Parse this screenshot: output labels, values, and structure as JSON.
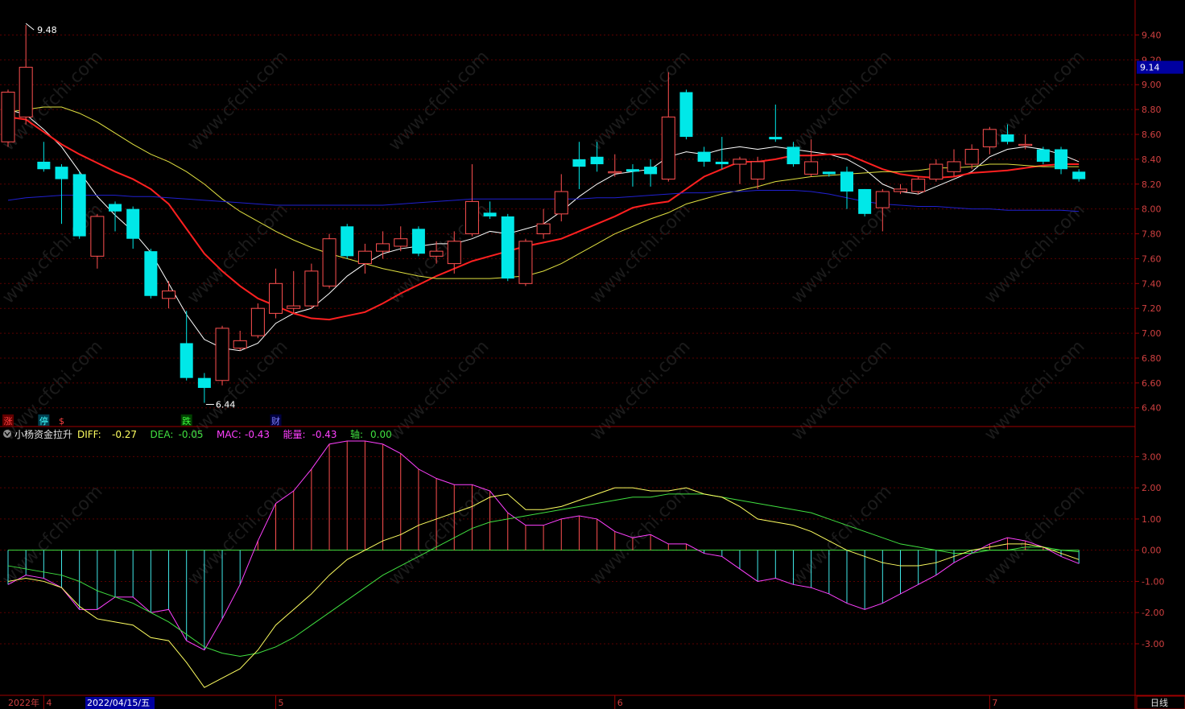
{
  "chart_data": {
    "type": "candlestick",
    "price_axis": {
      "ticks": [
        "9.40",
        "9.20",
        "9.00",
        "8.80",
        "8.60",
        "8.40",
        "8.20",
        "8.00",
        "7.80",
        "7.60",
        "7.40",
        "7.20",
        "7.00",
        "6.80",
        "6.60",
        "6.40"
      ],
      "range": [
        6.34,
        9.5
      ]
    },
    "current_price_tag": "9.14",
    "max_label": "9.48",
    "min_label": "6.44",
    "candles": [
      {
        "o": 8.54,
        "c": 8.94,
        "h": 8.96,
        "l": 8.5
      },
      {
        "o": 8.74,
        "c": 9.14,
        "h": 9.48,
        "l": 8.68
      },
      {
        "o": 8.38,
        "c": 8.32,
        "h": 8.54,
        "l": 8.3
      },
      {
        "o": 8.34,
        "c": 8.24,
        "h": 8.36,
        "l": 7.88
      },
      {
        "o": 8.28,
        "c": 7.78,
        "h": 8.3,
        "l": 7.76
      },
      {
        "o": 7.62,
        "c": 7.94,
        "h": 7.96,
        "l": 7.52
      },
      {
        "o": 8.04,
        "c": 7.98,
        "h": 8.06,
        "l": 7.82
      },
      {
        "o": 8.0,
        "c": 7.76,
        "h": 8.02,
        "l": 7.68
      },
      {
        "o": 7.66,
        "c": 7.3,
        "h": 7.68,
        "l": 7.28
      },
      {
        "o": 7.28,
        "c": 7.34,
        "h": 7.42,
        "l": 7.2
      },
      {
        "o": 6.92,
        "c": 6.64,
        "h": 7.18,
        "l": 6.62
      },
      {
        "o": 6.64,
        "c": 6.56,
        "h": 6.68,
        "l": 6.44
      },
      {
        "o": 6.62,
        "c": 7.04,
        "h": 7.06,
        "l": 6.58
      },
      {
        "o": 6.88,
        "c": 6.94,
        "h": 7.02,
        "l": 6.86
      },
      {
        "o": 6.98,
        "c": 7.2,
        "h": 7.24,
        "l": 6.96
      },
      {
        "o": 7.16,
        "c": 7.4,
        "h": 7.52,
        "l": 7.12
      },
      {
        "o": 7.2,
        "c": 7.22,
        "h": 7.5,
        "l": 7.16
      },
      {
        "o": 7.22,
        "c": 7.5,
        "h": 7.56,
        "l": 7.2
      },
      {
        "o": 7.38,
        "c": 7.76,
        "h": 7.8,
        "l": 7.36
      },
      {
        "o": 7.86,
        "c": 7.62,
        "h": 7.88,
        "l": 7.6
      },
      {
        "o": 7.56,
        "c": 7.66,
        "h": 7.72,
        "l": 7.48
      },
      {
        "o": 7.66,
        "c": 7.72,
        "h": 7.82,
        "l": 7.6
      },
      {
        "o": 7.7,
        "c": 7.76,
        "h": 7.86,
        "l": 7.66
      },
      {
        "o": 7.84,
        "c": 7.64,
        "h": 7.86,
        "l": 7.62
      },
      {
        "o": 7.62,
        "c": 7.66,
        "h": 7.74,
        "l": 7.56
      },
      {
        "o": 7.56,
        "c": 7.74,
        "h": 7.82,
        "l": 7.48
      },
      {
        "o": 7.8,
        "c": 8.06,
        "h": 8.36,
        "l": 7.78
      },
      {
        "o": 7.97,
        "c": 7.94,
        "h": 8.06,
        "l": 7.92
      },
      {
        "o": 7.94,
        "c": 7.44,
        "h": 7.96,
        "l": 7.42
      },
      {
        "o": 7.4,
        "c": 7.74,
        "h": 7.76,
        "l": 7.38
      },
      {
        "o": 7.8,
        "c": 7.88,
        "h": 8.0,
        "l": 7.76
      },
      {
        "o": 7.96,
        "c": 8.14,
        "h": 8.28,
        "l": 7.9
      },
      {
        "o": 8.4,
        "c": 8.34,
        "h": 8.54,
        "l": 8.16
      },
      {
        "o": 8.42,
        "c": 8.36,
        "h": 8.54,
        "l": 8.3
      },
      {
        "o": 8.3,
        "c": 8.3,
        "h": 8.44,
        "l": 8.26
      },
      {
        "o": 8.32,
        "c": 8.3,
        "h": 8.36,
        "l": 8.18
      },
      {
        "o": 8.34,
        "c": 8.28,
        "h": 8.4,
        "l": 8.18
      },
      {
        "o": 8.24,
        "c": 8.74,
        "h": 9.1,
        "l": 8.22
      },
      {
        "o": 8.94,
        "c": 8.58,
        "h": 8.96,
        "l": 8.56
      },
      {
        "o": 8.46,
        "c": 8.38,
        "h": 8.5,
        "l": 8.34
      },
      {
        "o": 8.38,
        "c": 8.36,
        "h": 8.58,
        "l": 8.32
      },
      {
        "o": 8.36,
        "c": 8.4,
        "h": 8.42,
        "l": 8.2
      },
      {
        "o": 8.24,
        "c": 8.38,
        "h": 8.42,
        "l": 8.16
      },
      {
        "o": 8.58,
        "c": 8.56,
        "h": 8.84,
        "l": 8.54
      },
      {
        "o": 8.5,
        "c": 8.36,
        "h": 8.54,
        "l": 8.34
      },
      {
        "o": 8.28,
        "c": 8.38,
        "h": 8.56,
        "l": 8.26
      },
      {
        "o": 8.3,
        "c": 8.28,
        "h": 8.3,
        "l": 8.26
      },
      {
        "o": 8.3,
        "c": 8.14,
        "h": 8.34,
        "l": 8.0
      },
      {
        "o": 8.16,
        "c": 7.96,
        "h": 8.16,
        "l": 7.94
      },
      {
        "o": 8.01,
        "c": 8.14,
        "h": 8.16,
        "l": 7.82
      },
      {
        "o": 8.14,
        "c": 8.16,
        "h": 8.2,
        "l": 8.12
      },
      {
        "o": 8.14,
        "c": 8.24,
        "h": 8.26,
        "l": 8.12
      },
      {
        "o": 8.24,
        "c": 8.36,
        "h": 8.4,
        "l": 8.22
      },
      {
        "o": 8.3,
        "c": 8.38,
        "h": 8.48,
        "l": 8.26
      },
      {
        "o": 8.36,
        "c": 8.48,
        "h": 8.52,
        "l": 8.32
      },
      {
        "o": 8.5,
        "c": 8.64,
        "h": 8.66,
        "l": 8.44
      },
      {
        "o": 8.6,
        "c": 8.54,
        "h": 8.68,
        "l": 8.52
      },
      {
        "o": 8.52,
        "c": 8.52,
        "h": 8.6,
        "l": 8.48
      },
      {
        "o": 8.48,
        "c": 8.38,
        "h": 8.5,
        "l": 8.36
      },
      {
        "o": 8.48,
        "c": 8.32,
        "h": 8.5,
        "l": 8.28
      },
      {
        "o": 8.3,
        "c": 8.24,
        "h": 8.32,
        "l": 8.22
      }
    ],
    "ma_lines": [
      {
        "name": "MA5",
        "color": "#ffffff",
        "values": [
          8.8,
          8.76,
          8.64,
          8.5,
          8.3,
          8.1,
          7.95,
          7.82,
          7.65,
          7.4,
          7.15,
          6.95,
          6.88,
          6.86,
          6.92,
          7.08,
          7.16,
          7.2,
          7.32,
          7.46,
          7.56,
          7.64,
          7.68,
          7.7,
          7.72,
          7.72,
          7.76,
          7.82,
          7.8,
          7.84,
          7.88,
          7.98,
          8.1,
          8.2,
          8.28,
          8.3,
          8.32,
          8.42,
          8.46,
          8.44,
          8.48,
          8.5,
          8.48,
          8.5,
          8.48,
          8.46,
          8.44,
          8.4,
          8.32,
          8.2,
          8.14,
          8.12,
          8.18,
          8.24,
          8.3,
          8.42,
          8.48,
          8.5,
          8.48,
          8.44,
          8.38
        ]
      },
      {
        "name": "MA10",
        "color": "#ff2020",
        "values": [
          8.74,
          8.72,
          8.62,
          8.52,
          8.44,
          8.37,
          8.3,
          8.24,
          8.16,
          8.04,
          7.84,
          7.64,
          7.5,
          7.38,
          7.28,
          7.22,
          7.16,
          7.12,
          7.11,
          7.14,
          7.17,
          7.24,
          7.32,
          7.39,
          7.46,
          7.52,
          7.58,
          7.62,
          7.66,
          7.7,
          7.73,
          7.76,
          7.82,
          7.88,
          7.94,
          8.01,
          8.04,
          8.06,
          8.16,
          8.26,
          8.32,
          8.38,
          8.38,
          8.4,
          8.43,
          8.43,
          8.44,
          8.44,
          8.38,
          8.32,
          8.28,
          8.26,
          8.25,
          8.26,
          8.29,
          8.3,
          8.31,
          8.33,
          8.35,
          8.36,
          8.36
        ]
      },
      {
        "name": "MA20",
        "color": "#e0e040",
        "values": [
          8.78,
          8.8,
          8.82,
          8.82,
          8.77,
          8.7,
          8.61,
          8.52,
          8.44,
          8.38,
          8.3,
          8.2,
          8.08,
          7.98,
          7.9,
          7.82,
          7.75,
          7.69,
          7.64,
          7.6,
          7.56,
          7.52,
          7.49,
          7.46,
          7.44,
          7.44,
          7.44,
          7.44,
          7.45,
          7.46,
          7.5,
          7.56,
          7.64,
          7.72,
          7.8,
          7.86,
          7.92,
          7.97,
          8.04,
          8.08,
          8.12,
          8.15,
          8.18,
          8.22,
          8.24,
          8.26,
          8.27,
          8.28,
          8.29,
          8.3,
          8.3,
          8.31,
          8.33,
          8.33,
          8.34,
          8.36,
          8.36,
          8.35,
          8.34,
          8.34,
          8.34
        ]
      },
      {
        "name": "MA60",
        "color": "#2020d0",
        "values": [
          8.07,
          8.09,
          8.1,
          8.11,
          8.11,
          8.11,
          8.11,
          8.1,
          8.1,
          8.09,
          8.08,
          8.07,
          8.06,
          8.05,
          8.04,
          8.03,
          8.03,
          8.03,
          8.03,
          8.03,
          8.03,
          8.03,
          8.04,
          8.05,
          8.06,
          8.07,
          8.08,
          8.08,
          8.08,
          8.08,
          8.08,
          8.08,
          8.08,
          8.09,
          8.09,
          8.1,
          8.11,
          8.12,
          8.13,
          8.13,
          8.14,
          8.14,
          8.15,
          8.15,
          8.15,
          8.14,
          8.12,
          8.09,
          8.06,
          8.04,
          8.03,
          8.02,
          8.02,
          8.01,
          8.0,
          8.0,
          7.99,
          7.99,
          7.99,
          7.99,
          7.98
        ]
      }
    ],
    "signal_marks": [
      {
        "text": "涨",
        "color": "#ff4040",
        "bg": "#600000",
        "i": 0
      },
      {
        "text": "停",
        "color": "#40ffff",
        "bg": "#004050",
        "i": 2
      },
      {
        "text": "$",
        "color": "#ff4040",
        "bg": "",
        "i": 3
      },
      {
        "text": "跌",
        "color": "#40ff40",
        "bg": "#004000",
        "i": 10
      },
      {
        "text": "财",
        "color": "#8080ff",
        "bg": "#000040",
        "i": 15
      }
    ],
    "indicator": {
      "name": "小杨资金拉升",
      "parts": [
        {
          "label": "DIFF:",
          "value": "-0.27",
          "color": "#ffff60"
        },
        {
          "label": "DEA:",
          "value": "-0.05",
          "color": "#40e040"
        },
        {
          "label": "MAC:",
          "value": "-0.43",
          "color": "#ff40ff"
        },
        {
          "label": "能量:",
          "value": "-0.43",
          "color": "#ff40ff"
        },
        {
          "label": "轴:",
          "value": "0.00",
          "color": "#40e040"
        }
      ],
      "ticks": [
        "3.00",
        "2.00",
        "1.00",
        "0.00",
        "-1.00",
        "-2.00",
        "-3.00"
      ],
      "range": [
        -4.6,
        3.5
      ],
      "diff": [
        -1.0,
        -0.9,
        -1.0,
        -1.2,
        -1.8,
        -2.2,
        -2.3,
        -2.4,
        -2.8,
        -2.9,
        -3.6,
        -4.4,
        -4.1,
        -3.8,
        -3.2,
        -2.4,
        -1.9,
        -1.4,
        -0.8,
        -0.3,
        0.0,
        0.3,
        0.5,
        0.8,
        1.0,
        1.2,
        1.4,
        1.7,
        1.8,
        1.3,
        1.3,
        1.4,
        1.6,
        1.8,
        2.0,
        2.0,
        1.9,
        1.9,
        2.0,
        1.8,
        1.7,
        1.4,
        1.0,
        0.9,
        0.8,
        0.6,
        0.3,
        0.0,
        -0.2,
        -0.4,
        -0.5,
        -0.5,
        -0.4,
        -0.2,
        0.0,
        0.1,
        0.2,
        0.2,
        0.1,
        -0.1,
        -0.3
      ],
      "dea": [
        -0.5,
        -0.6,
        -0.7,
        -0.8,
        -1.0,
        -1.3,
        -1.5,
        -1.7,
        -2.0,
        -2.3,
        -2.7,
        -3.1,
        -3.3,
        -3.4,
        -3.3,
        -3.1,
        -2.8,
        -2.4,
        -2.0,
        -1.6,
        -1.2,
        -0.8,
        -0.5,
        -0.2,
        0.1,
        0.4,
        0.7,
        0.9,
        1.0,
        1.1,
        1.2,
        1.3,
        1.4,
        1.5,
        1.6,
        1.7,
        1.7,
        1.8,
        1.8,
        1.8,
        1.7,
        1.6,
        1.5,
        1.4,
        1.3,
        1.2,
        1.0,
        0.8,
        0.6,
        0.4,
        0.2,
        0.1,
        0.0,
        -0.1,
        -0.1,
        0.0,
        0.0,
        0.1,
        0.1,
        0.0,
        -0.05
      ],
      "mac": [
        -1.1,
        -0.8,
        -0.9,
        -1.2,
        -1.9,
        -1.9,
        -1.5,
        -1.5,
        -2.0,
        -1.9,
        -2.9,
        -3.2,
        -2.2,
        -1.1,
        0.3,
        1.5,
        1.9,
        2.6,
        3.4,
        3.5,
        3.5,
        3.4,
        3.1,
        2.6,
        2.3,
        2.1,
        2.1,
        1.9,
        1.2,
        0.8,
        0.8,
        1.0,
        1.1,
        1.0,
        0.6,
        0.4,
        0.5,
        0.2,
        0.2,
        -0.1,
        -0.2,
        -0.6,
        -1.0,
        -0.9,
        -1.1,
        -1.2,
        -1.4,
        -1.7,
        -1.9,
        -1.7,
        -1.4,
        -1.1,
        -0.8,
        -0.4,
        -0.1,
        0.2,
        0.4,
        0.3,
        0.1,
        -0.2,
        -0.43
      ]
    },
    "x_axis": {
      "year_label": "2022年",
      "cursor_date": "2022/04/15/五",
      "month_marks": [
        {
          "text": "4",
          "i": 2
        },
        {
          "text": "5",
          "i": 15
        },
        {
          "text": "6",
          "i": 34
        },
        {
          "text": "7",
          "i": 55
        }
      ]
    }
  },
  "status": {
    "period_label": "日线"
  },
  "watermark": "www.cfchi.com"
}
